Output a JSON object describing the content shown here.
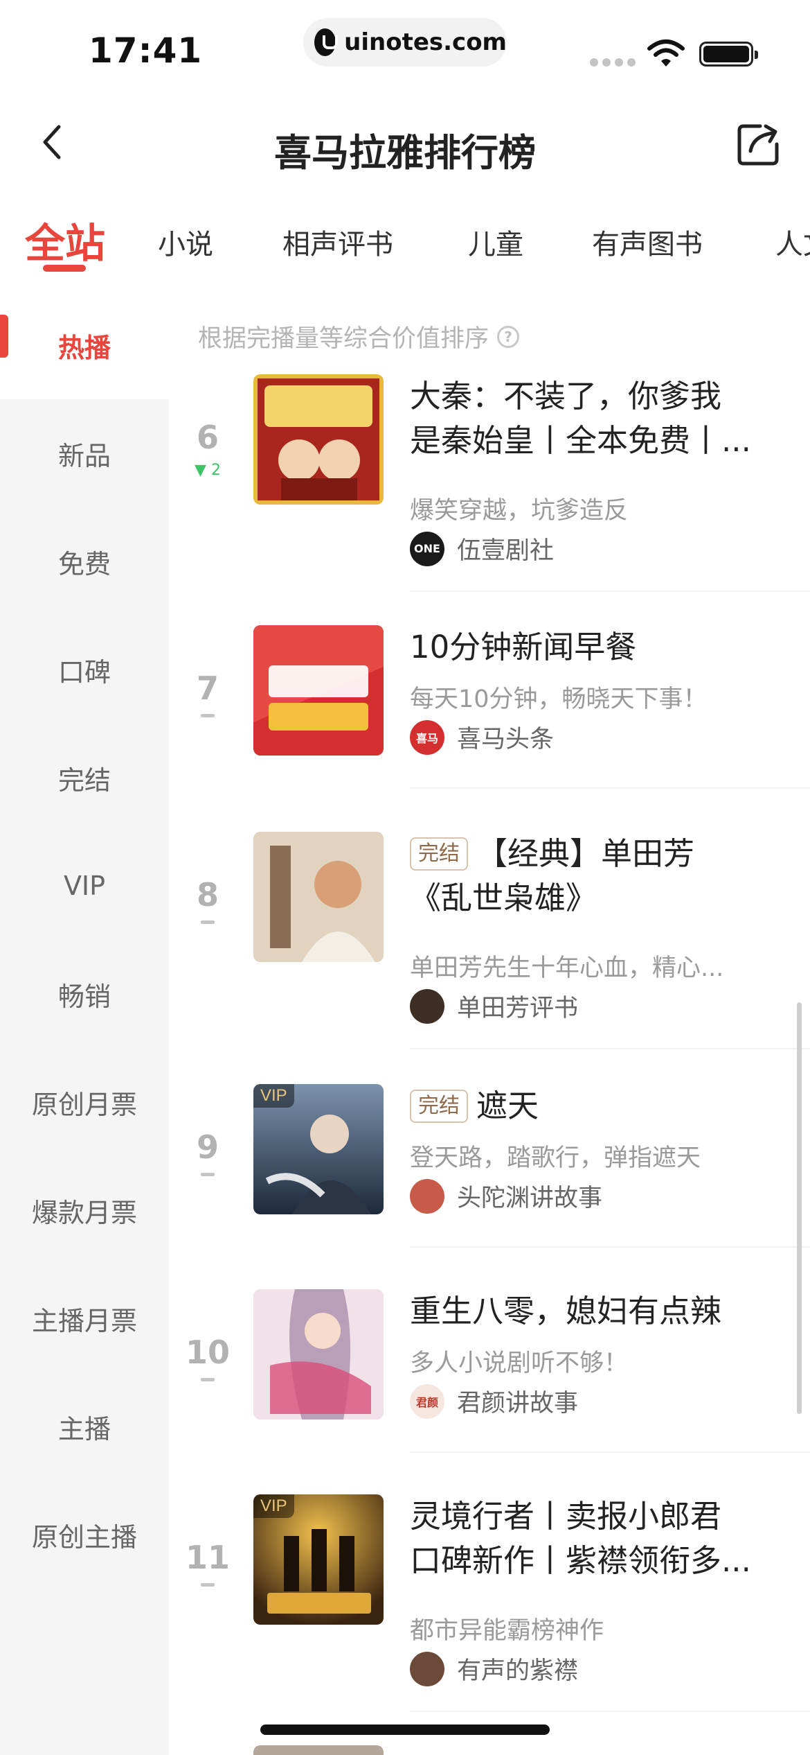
{
  "status_bar": {
    "time": "17:41",
    "url": "uinotes.com",
    "icons": [
      "signal-icon",
      "wifi-icon",
      "battery-icon"
    ]
  },
  "header": {
    "title": "喜马拉雅排行榜",
    "back_icon": "chevron-left-icon",
    "share_icon": "share-icon"
  },
  "tabs": [
    {
      "label": "全站",
      "active": true
    },
    {
      "label": "小说"
    },
    {
      "label": "相声评书"
    },
    {
      "label": "儿童"
    },
    {
      "label": "有声图书"
    },
    {
      "label": "人文"
    }
  ],
  "sidebar": {
    "items": [
      {
        "label": "热播",
        "active": true
      },
      {
        "label": "新品"
      },
      {
        "label": "免费"
      },
      {
        "label": "口碑"
      },
      {
        "label": "完结"
      },
      {
        "label": "VIP"
      },
      {
        "label": "畅销"
      },
      {
        "label": "原创月票"
      },
      {
        "label": "爆款月票"
      },
      {
        "label": "主播月票"
      },
      {
        "label": "主播"
      },
      {
        "label": "原创主播"
      }
    ]
  },
  "list": {
    "hint": "根据完播量等综合价值排序",
    "hint_icon": "question-icon",
    "done_tag": "完结",
    "vip_badge": "VIP",
    "items": [
      {
        "rank": "6",
        "trend": "▼ 2",
        "title_line1": "大秦：不装了，你爹我",
        "title_line2": "是秦始皇丨全本免费丨...",
        "desc": "爆笑穿越，坑爹造反",
        "author": "伍壹剧社",
        "accent": "#c0392b"
      },
      {
        "rank": "7",
        "title_line1": "10分钟新闻早餐",
        "desc": "每天10分钟，畅晓天下事！",
        "author": "喜马头条",
        "accent": "#d32f2f"
      },
      {
        "rank": "8",
        "done": true,
        "title_line1": "【经典】单田芳",
        "title_line2": "《乱世枭雄》",
        "desc": "单田芳先生十年心血，精心...",
        "author": "单田芳评书",
        "accent": "#8b6a4f"
      },
      {
        "rank": "9",
        "done": true,
        "vip": true,
        "title_line1": "遮天",
        "desc": "登天路，踏歌行，弹指遮天",
        "author": "头陀渊讲故事",
        "accent": "#2d3e56"
      },
      {
        "rank": "10",
        "title_line1": "重生八零，媳妇有点辣",
        "desc": "多人小说剧听不够！",
        "author": "君颜讲故事",
        "accent": "#d9a3b6"
      },
      {
        "rank": "11",
        "vip": true,
        "title_line1": "灵境行者丨卖报小郎君",
        "title_line2": "口碑新作丨紫襟领衔多...",
        "desc": "都市异能霸榜神作",
        "author": "有声的紫襟",
        "accent": "#7a5a1e"
      }
    ]
  }
}
